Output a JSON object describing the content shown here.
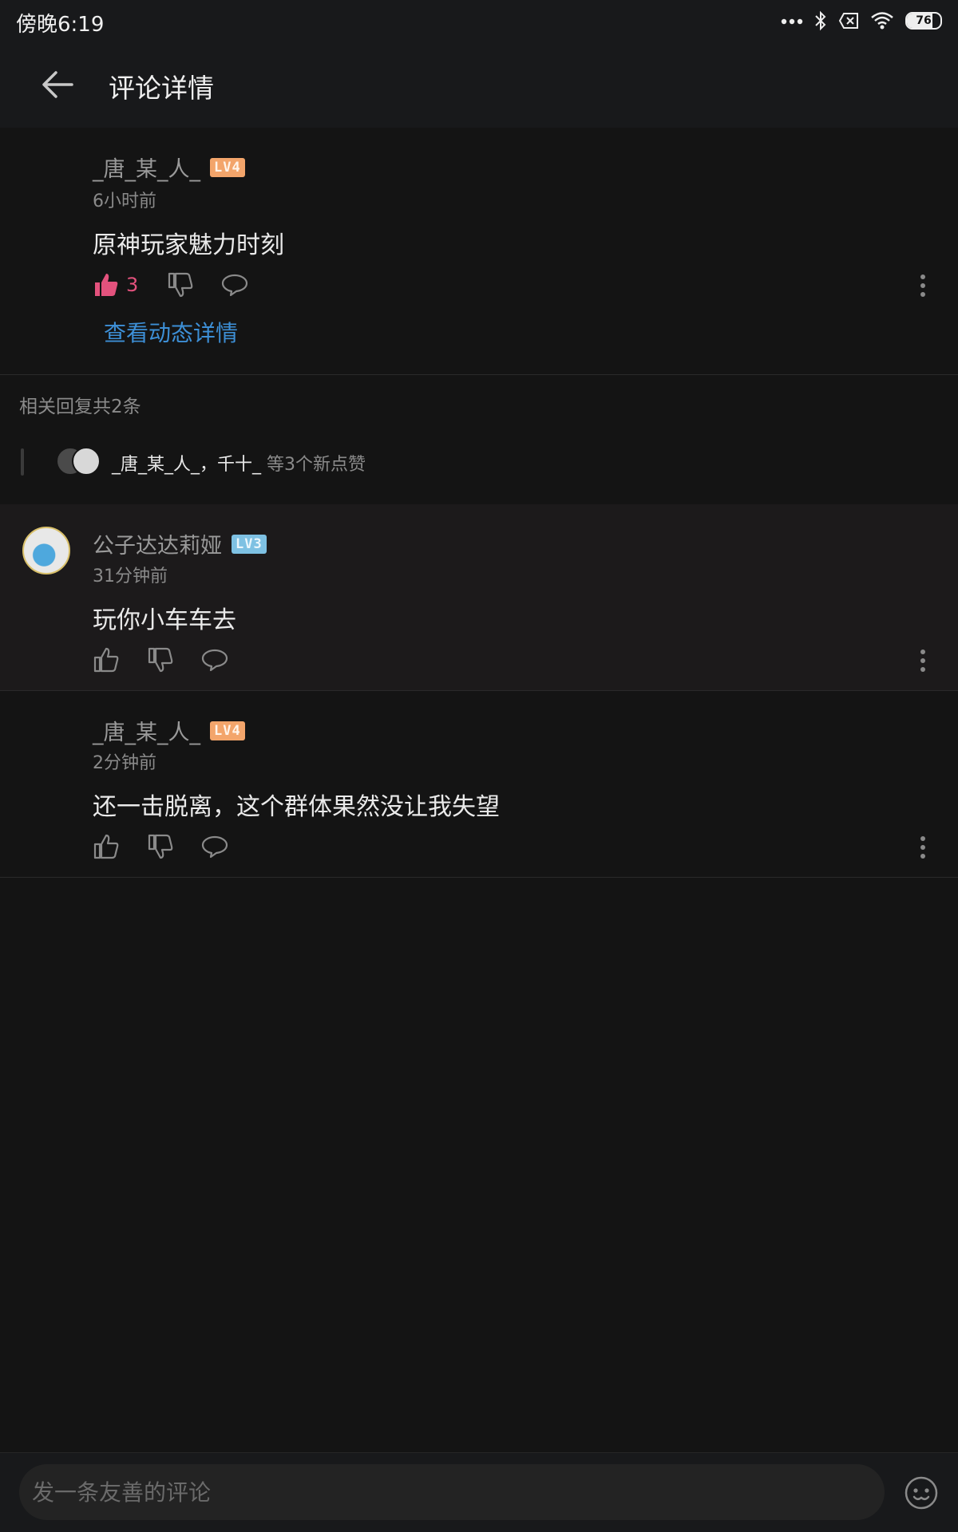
{
  "status_bar": {
    "time": "傍晚6:19",
    "battery": "76"
  },
  "header": {
    "title": "评论详情"
  },
  "main_comment": {
    "user": "_唐_某_人_",
    "level": "LV4",
    "time": "6小时前",
    "text": "原神玩家魅力时刻",
    "like_count": "3",
    "view_detail": "查看动态详情"
  },
  "replies": {
    "header": "相关回复共2条",
    "likers_names": "_唐_某_人_，千十_",
    "likers_suffix": " 等3个新点赞",
    "items": [
      {
        "user": "公子达达莉娅",
        "level": "LV3",
        "time": "31分钟前",
        "text": "玩你小车车去"
      },
      {
        "user": "_唐_某_人_",
        "level": "LV4",
        "time": "2分钟前",
        "text": "还一击脱离，这个群体果然没让我失望"
      }
    ]
  },
  "composer": {
    "placeholder": "发一条友善的评论"
  },
  "colors": {
    "background": "#141414",
    "accent_pink": "#e3527d",
    "link_blue": "#3d8fd6",
    "lv4_badge": "#f3a56b",
    "lv3_badge": "#7ec1e3"
  },
  "icons": [
    "back-arrow-icon",
    "like-icon",
    "dislike-icon",
    "reply-icon",
    "more-icon",
    "emoji-icon",
    "signal-icon",
    "bluetooth-icon",
    "sim-icon",
    "wifi-icon",
    "battery-icon"
  ]
}
